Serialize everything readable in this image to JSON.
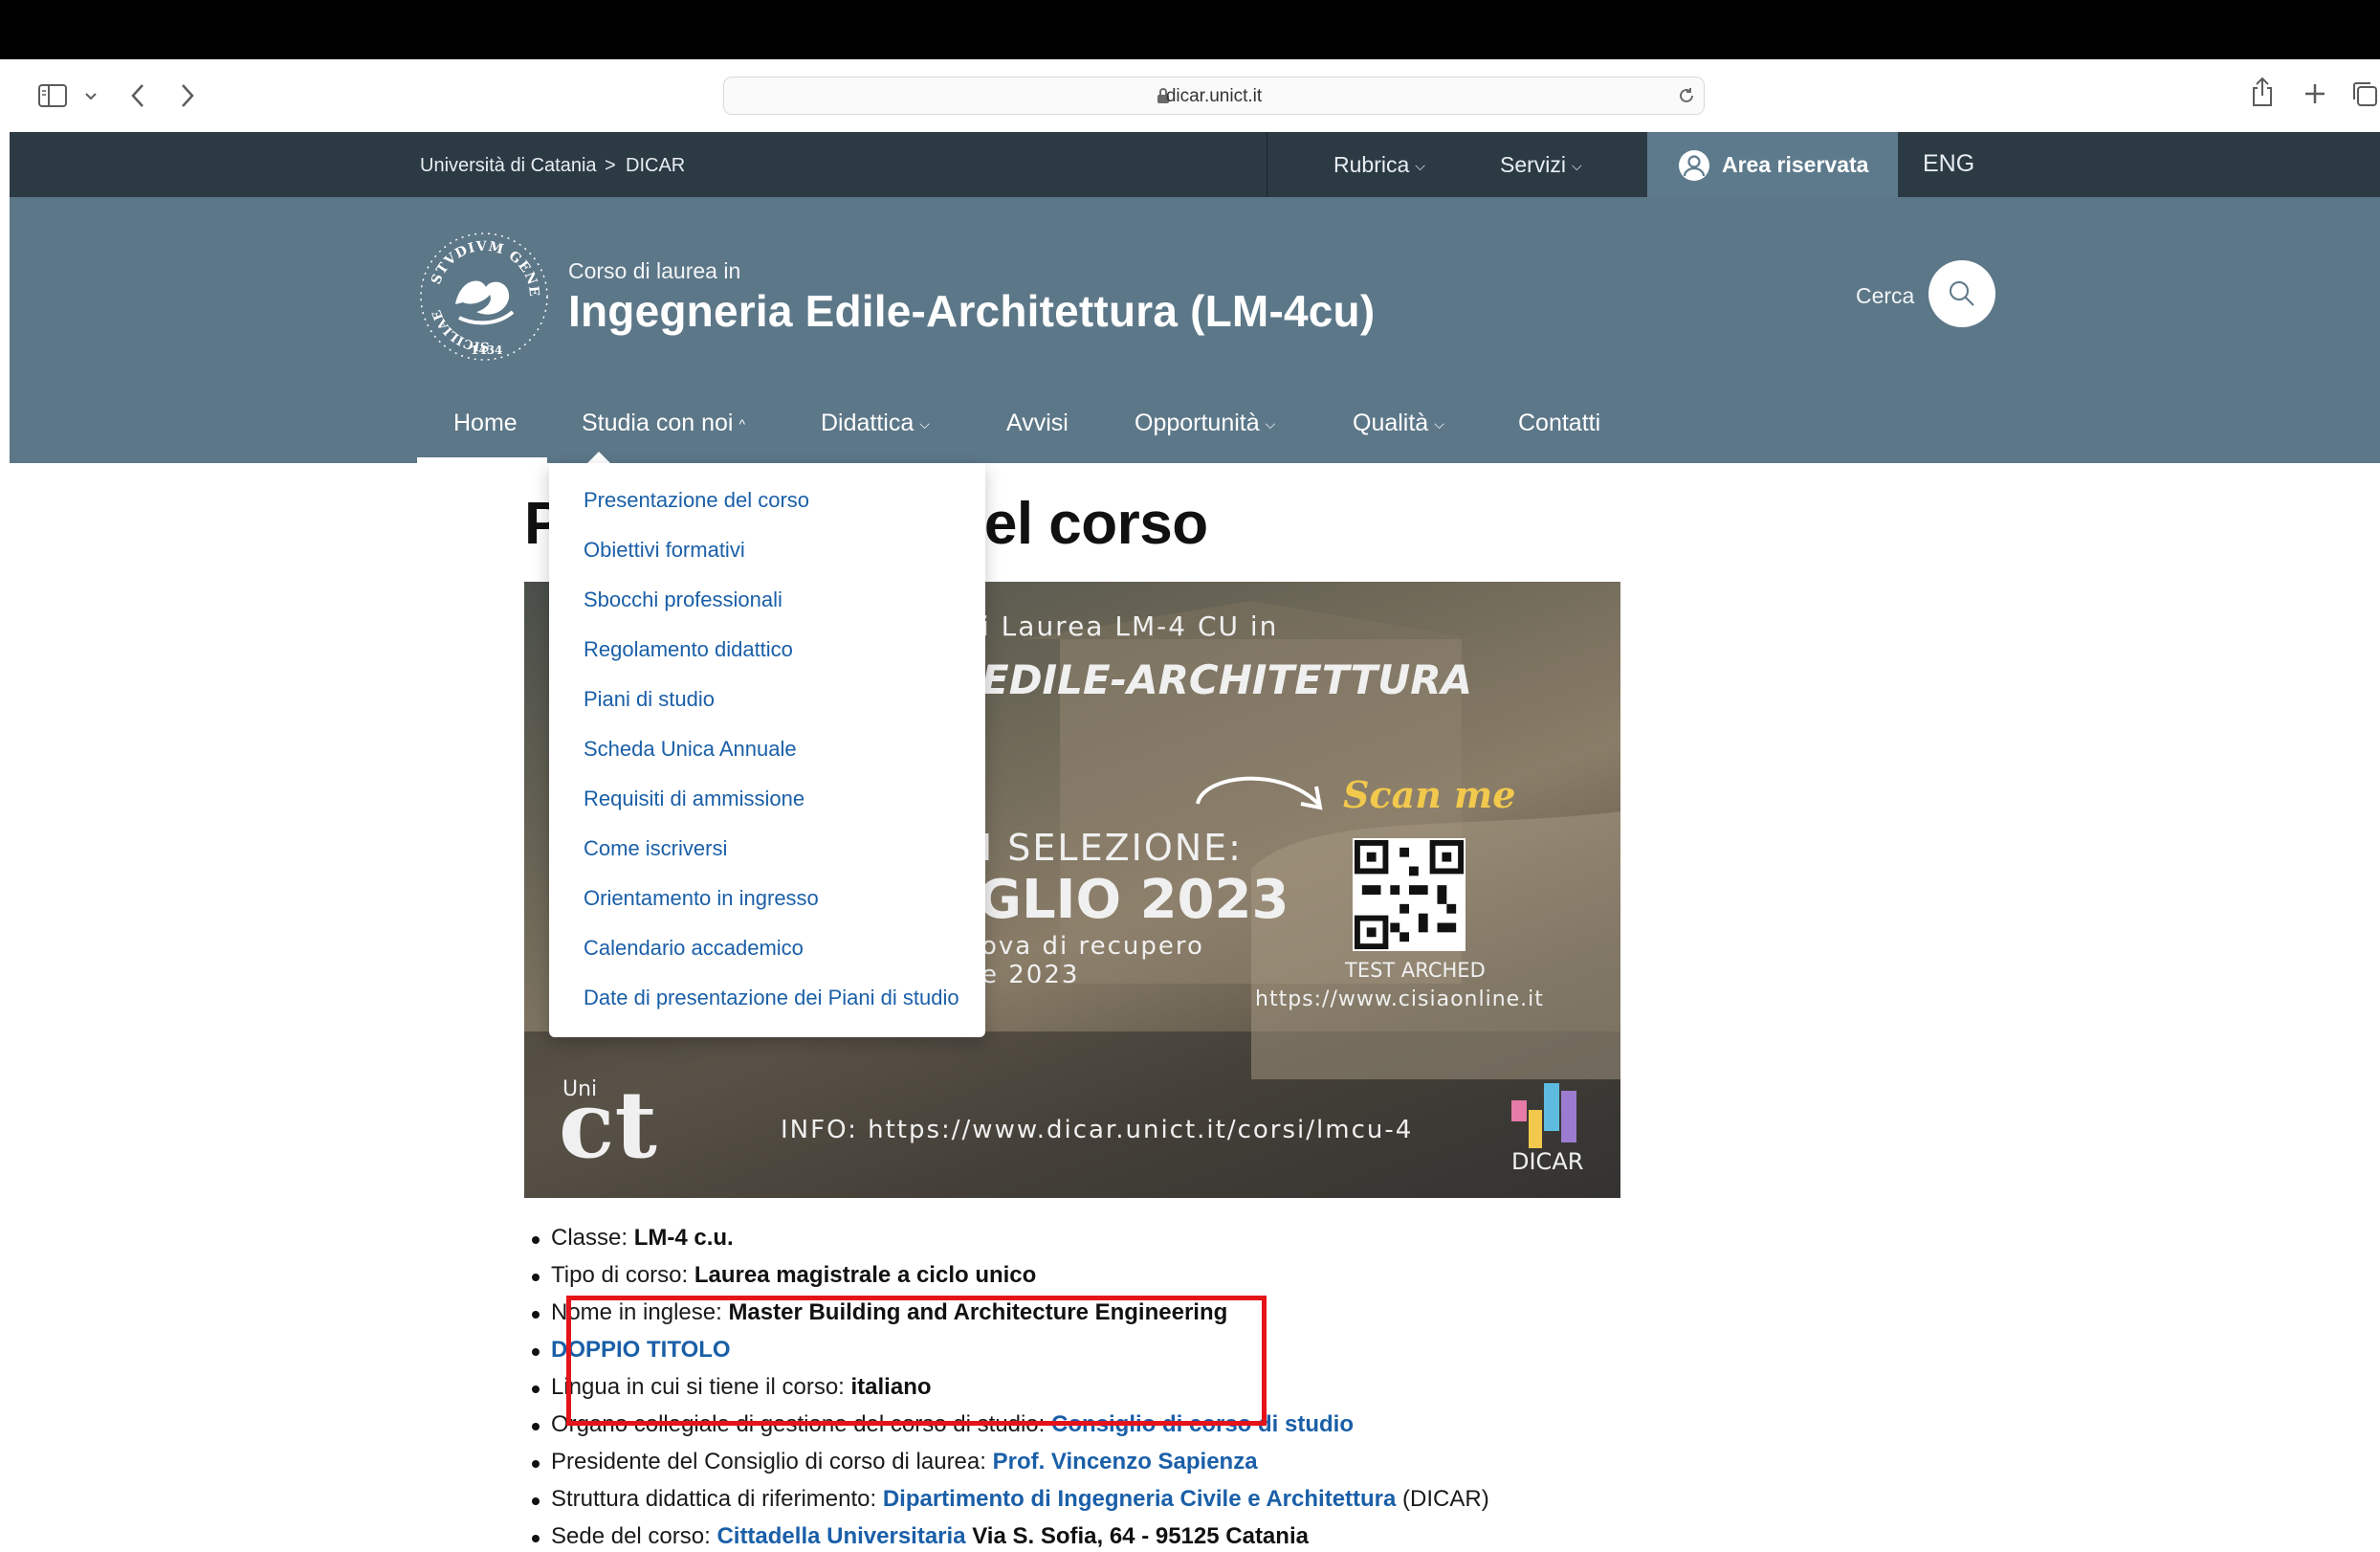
{
  "browser": {
    "url": "dicar.unict.it",
    "icons": [
      "sidebar-icon",
      "chevron-down-icon",
      "back-icon",
      "forward-icon",
      "lock-icon",
      "reload-icon",
      "share-icon",
      "new-tab-icon",
      "tabs-overview-icon"
    ]
  },
  "utility_bar": {
    "breadcrumb": [
      "Università di Catania",
      ">",
      "DICAR"
    ],
    "menus": [
      "Rubrica",
      "Servizi"
    ],
    "area_riservata": "Area riservata",
    "lang": "ENG"
  },
  "header": {
    "subtitle": "Corso di laurea in",
    "title": "Ingegneria Edile-Architettura (LM-4cu)",
    "search_label": "Cerca",
    "logo_text": "SICILIAE STVDIVM GENERALE 1434"
  },
  "nav": {
    "items": [
      "Home",
      "Studia con noi",
      "Didattica",
      "Avvisi",
      "Opportunità",
      "Qualità",
      "Contatti"
    ],
    "active": "Home",
    "open": "Studia con noi"
  },
  "dropdown": {
    "items": [
      "Presentazione del corso",
      "Obiettivi formativi",
      "Sbocchi professionali",
      "Regolamento didattico",
      "Piani di studio",
      "Scheda Unica Annuale",
      "Requisiti di ammissione",
      "Come iscriversi",
      "Orientamento in ingresso",
      "Calendario accademico",
      "Date di presentazione dei Piani di studio"
    ]
  },
  "page": {
    "heading_left": "P",
    "heading_right": "el corso"
  },
  "banner": {
    "line1": "i Laurea LM-4 CU in",
    "line2": "EDILE-ARCHITETTURA",
    "line3": "I SELEZIONE:",
    "line4": "GLIO 2023",
    "line5": "ova di recupero",
    "line6": "e 2023",
    "scan": "Scan me",
    "test": "TEST ARCHED",
    "cisia": "https://www.cisiaonline.it",
    "info": "INFO: https://www.dicar.unict.it/corsi/lmcu-4",
    "logo_uni": "Uni",
    "logo_ct": "ct",
    "logo_dicar": "DICAR"
  },
  "info": {
    "classe_label": "Classe: ",
    "classe_value": "LM-4 c.u.",
    "tipo_label": "Tipo di corso: ",
    "tipo_value": "Laurea magistrale a ciclo unico",
    "nome_label": "Nome in inglese: ",
    "nome_value": "Master Building and Architecture Engineering",
    "doppio": "DOPPIO TITOLO",
    "lingua_label": "Lingua in cui si tiene il corso: ",
    "lingua_value": "italiano",
    "organo_label": "Organo collegiale di gestione del corso di studio: ",
    "organo_link": "Consiglio di corso di studio",
    "presidente_label": "Presidente del Consiglio di corso di laurea: ",
    "presidente_link": "Prof. Vincenzo Sapienza",
    "struttura_label": "Struttura didattica di riferimento: ",
    "struttura_link": "Dipartimento di Ingegneria Civile e Architettura",
    "struttura_suffix": " (DICAR)",
    "sede_label": "Sede del corso: ",
    "sede_link": "Cittadella Universitaria",
    "sede_value": " Via S. Sofia, 64 - 95125 Catania"
  },
  "colors": {
    "utility_bar": "#2c3a44",
    "header": "#5c7788",
    "area_riservata_bg": "#5d7a8c",
    "link": "#1a5fa8",
    "highlight_box": "#e5131a"
  }
}
